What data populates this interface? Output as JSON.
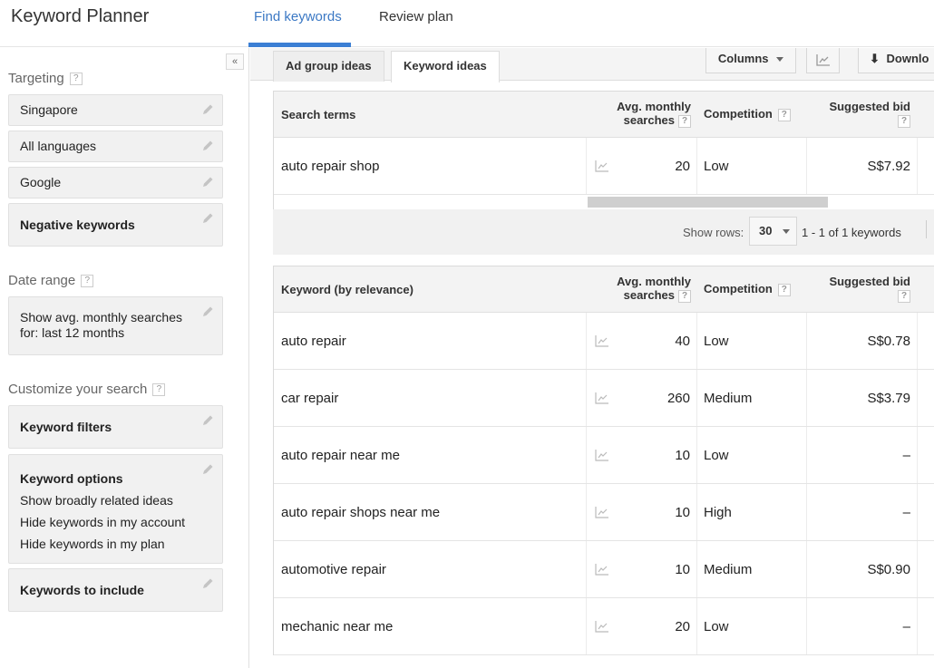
{
  "app": {
    "title": "Keyword Planner",
    "nav_tabs": [
      {
        "label": "Find keywords",
        "active": true
      },
      {
        "label": "Review plan",
        "active": false
      }
    ],
    "accent_color": "#3b7fd4"
  },
  "sidebar": {
    "collapse_icon": "double-chevron-left-icon",
    "collapse_glyph": "«",
    "targeting": {
      "title": "Targeting",
      "help": "?",
      "items": [
        {
          "label": "Singapore",
          "bold": false
        },
        {
          "label": "All languages",
          "bold": false
        },
        {
          "label": "Google",
          "bold": false
        },
        {
          "label": "Negative keywords",
          "bold": true
        }
      ]
    },
    "date_range": {
      "title": "Date range",
      "help": "?",
      "line1": "Show avg. monthly searches",
      "line2": "for: last 12 months"
    },
    "customize": {
      "title": "Customize your search",
      "help": "?",
      "keyword_filters": "Keyword filters",
      "keyword_options": {
        "title": "Keyword options",
        "lines": [
          "Show broadly related ideas",
          "Hide keywords in my account",
          "Hide keywords in my plan"
        ]
      },
      "keywords_to_include": "Keywords to include"
    }
  },
  "main": {
    "subtabs": [
      {
        "label": "Ad group ideas",
        "active": false
      },
      {
        "label": "Keyword ideas",
        "active": true
      }
    ],
    "toolbar": {
      "columns_label": "Columns",
      "chart_icon": "line-chart-icon",
      "download_label": "Downlo"
    },
    "search_terms_table": {
      "headers": {
        "term": "Search terms",
        "searches_line1": "Avg. monthly",
        "searches_line2": "searches",
        "competition": "Competition",
        "bid": "Suggested bid",
        "help": "?"
      },
      "rows": [
        {
          "term": "auto repair shop",
          "searches": "20",
          "competition": "Low",
          "bid": "S$7.92"
        }
      ]
    },
    "pager": {
      "show_rows_label": "Show rows:",
      "rows_value": "30",
      "range_text": "1 - 1 of 1 keywords"
    },
    "keyword_table": {
      "headers": {
        "term": "Keyword (by relevance)",
        "searches_line1": "Avg. monthly",
        "searches_line2": "searches",
        "competition": "Competition",
        "bid": "Suggested bid",
        "help": "?"
      },
      "rows": [
        {
          "term": "auto repair",
          "searches": "40",
          "competition": "Low",
          "bid": "S$0.78"
        },
        {
          "term": "car repair",
          "searches": "260",
          "competition": "Medium",
          "bid": "S$3.79"
        },
        {
          "term": "auto repair near me",
          "searches": "10",
          "competition": "Low",
          "bid": "–"
        },
        {
          "term": "auto repair shops near me",
          "searches": "10",
          "competition": "High",
          "bid": "–"
        },
        {
          "term": "automotive repair",
          "searches": "10",
          "competition": "Medium",
          "bid": "S$0.90"
        },
        {
          "term": "mechanic near me",
          "searches": "20",
          "competition": "Low",
          "bid": "–"
        }
      ]
    }
  }
}
